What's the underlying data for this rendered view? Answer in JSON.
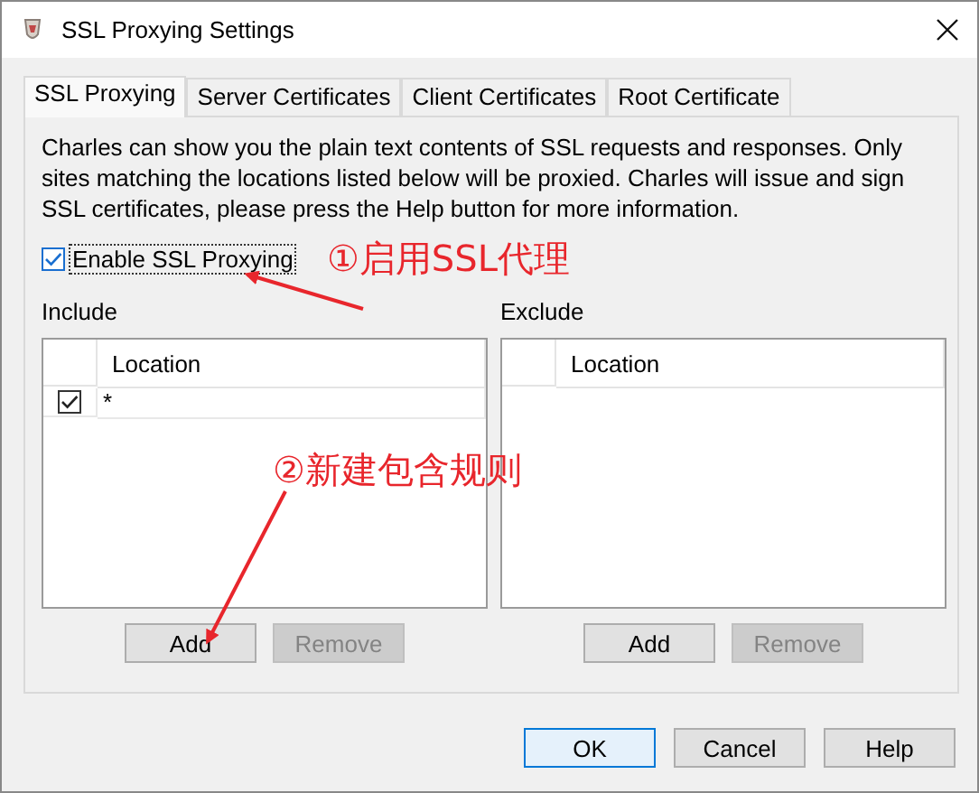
{
  "window": {
    "title": "SSL Proxying Settings"
  },
  "tabs": [
    {
      "label": "SSL Proxying",
      "selected": true
    },
    {
      "label": "Server Certificates",
      "selected": false
    },
    {
      "label": "Client Certificates",
      "selected": false
    },
    {
      "label": "Root Certificate",
      "selected": false
    }
  ],
  "description": "Charles can show you the plain text contents of SSL requests and responses. Only sites matching the locations listed below will be proxied. Charles will issue and sign SSL certificates, please press the Help button for more information.",
  "enable_checkbox": {
    "label": "Enable SSL Proxying",
    "checked": true
  },
  "lists": [
    {
      "label": "Include",
      "column": "Location",
      "rows": [
        {
          "checked": true,
          "location": "*"
        }
      ],
      "buttons": [
        {
          "label": "Add",
          "disabled": false
        },
        {
          "label": "Remove",
          "disabled": true
        }
      ]
    },
    {
      "label": "Exclude",
      "column": "Location",
      "buttons": [
        {
          "label": "Add",
          "disabled": false
        },
        {
          "label": "Remove",
          "disabled": true
        }
      ]
    }
  ],
  "buttons": [
    {
      "label": "OK",
      "default": true
    },
    {
      "label": "Cancel",
      "default": false
    },
    {
      "label": "Help",
      "default": false
    }
  ],
  "annotations": [
    {
      "text": "①启用SSL代理"
    },
    {
      "text": "②新建包含规则"
    }
  ]
}
